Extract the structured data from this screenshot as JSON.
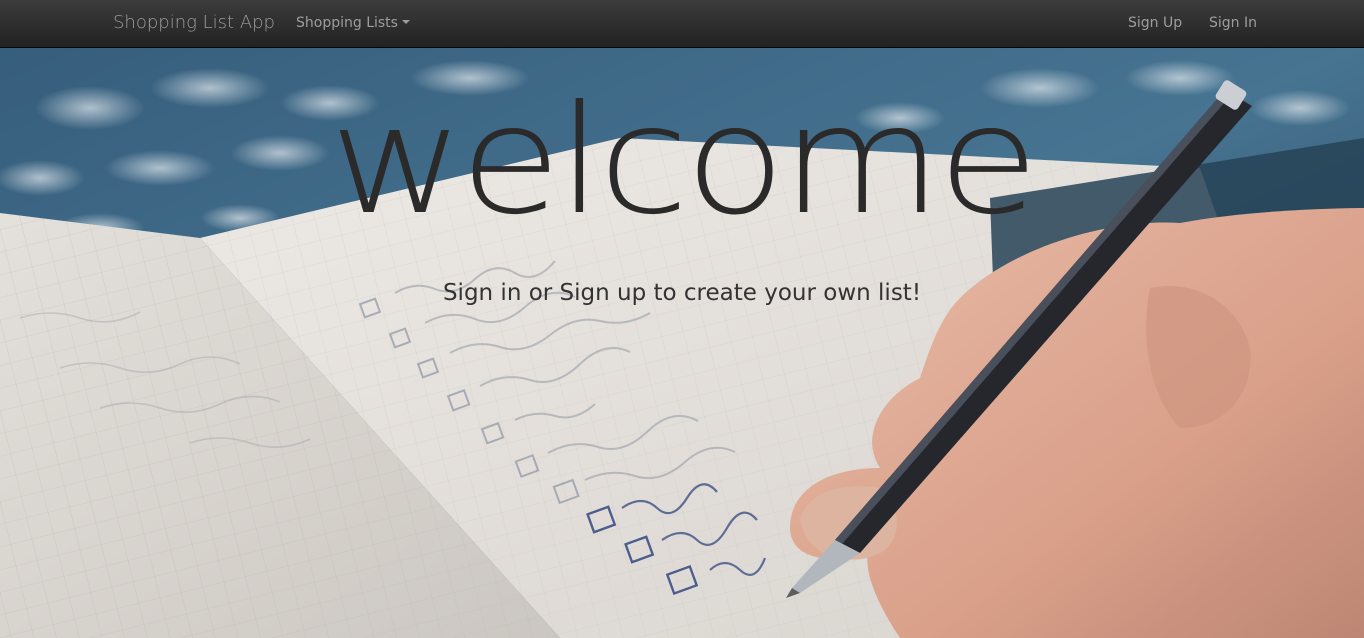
{
  "navbar": {
    "brand": "Shopping List App",
    "dropdown_label": "Shopping Lists",
    "signup_label": "Sign Up",
    "signin_label": "Sign In"
  },
  "hero": {
    "heading": "welcome",
    "tagline": "Sign in or Sign up to create your own list!",
    "background_image": "hand-writing-checklist-photo"
  },
  "colors": {
    "navbar_bg": "#2b2b2b",
    "nav_text": "#9d9d9d",
    "heading_text": "#2a2a2a"
  }
}
